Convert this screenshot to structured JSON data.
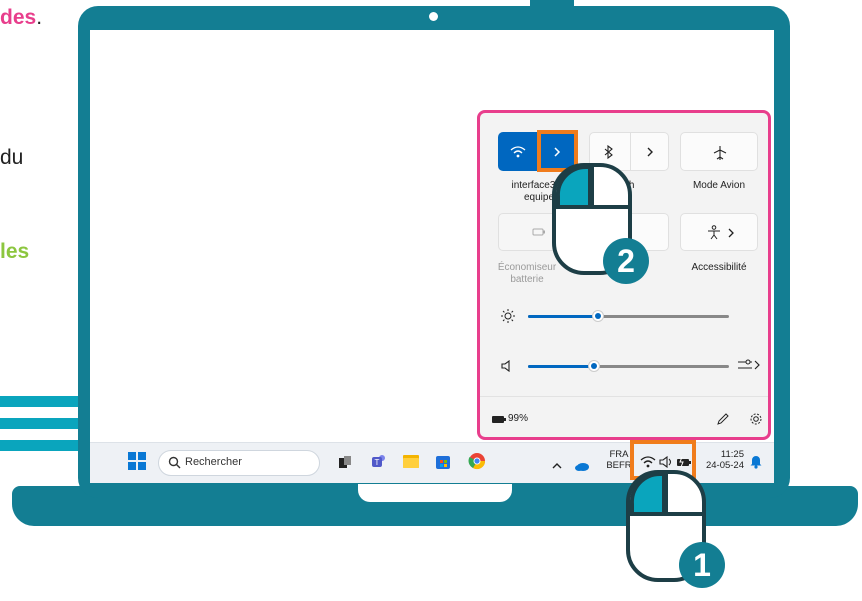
{
  "left_fragments": {
    "line1_colored": "des",
    "line1_end": ".",
    "line2": "du",
    "line3": "les"
  },
  "colors": {
    "teal": "#137e93",
    "accent_light": "#0aa5bd",
    "pink": "#e83e8c",
    "orange": "#f07c1c",
    "blue": "#0067c0",
    "green": "#8cc63f"
  },
  "taskbar": {
    "search_placeholder": "Rechercher",
    "lang_line1": "FRA",
    "lang_line2": "BEFR",
    "time": "11:25",
    "date": "24-05-24"
  },
  "quick_settings": {
    "wifi_label_line1": "interface3na",
    "wifi_label_line2": "equipe",
    "bluetooth_label": "ooth",
    "airplane_label": "Mode Avion",
    "battery_saver_line1": "Économiseur",
    "battery_saver_line2": "batterie",
    "accessibility_label": "Accessibilité",
    "battery_percent": "99%",
    "brightness_level": 0.35,
    "volume_level": 0.33
  },
  "steps": {
    "step1": "1",
    "step2": "2"
  }
}
